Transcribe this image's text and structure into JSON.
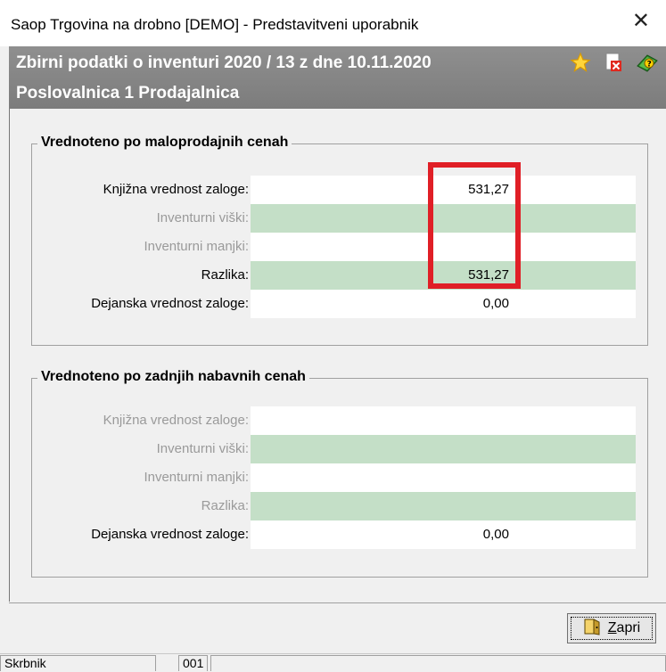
{
  "window": {
    "title": "Saop Trgovina na drobno [DEMO] - Predstavitveni uporabnik",
    "close_glyph": "✕"
  },
  "header": {
    "line1": "Zbirni podatki o inventuri 2020 / 13 z dne 10.11.2020",
    "line2": "Poslovalnica 1 Prodajalnica",
    "icons": [
      "star-icon",
      "pdf-delete-icon",
      "book-help-icon"
    ]
  },
  "group_retail": {
    "legend": "Vrednoteno po maloprodajnih cenah",
    "rows": [
      {
        "label": "Knjižna vrednost zaloge:",
        "value": "531,27"
      },
      {
        "label": "Inventurni viški:",
        "value": ""
      },
      {
        "label": "Inventurni manjki:",
        "value": ""
      },
      {
        "label": "Razlika:",
        "value": "531,27"
      },
      {
        "label": "Dejanska vrednost zaloge:",
        "value": "0,00"
      }
    ]
  },
  "group_purchase": {
    "legend": "Vrednoteno po zadnjih nabavnih cenah",
    "rows": [
      {
        "label": "Knjižna vrednost zaloge:",
        "value": ""
      },
      {
        "label": "Inventurni viški:",
        "value": ""
      },
      {
        "label": "Inventurni manjki:",
        "value": ""
      },
      {
        "label": "Razlika:",
        "value": ""
      },
      {
        "label": "Dejanska vrednost zaloge:",
        "value": "0,00"
      }
    ]
  },
  "buttons": {
    "close_label_underlined": "Z",
    "close_label_rest": "apri"
  },
  "statusbar": {
    "cell1": "Skrbnik",
    "cell2": "001",
    "cell3": ""
  },
  "colors": {
    "row_green": "#c4dfc7",
    "header_gray": "#828282",
    "highlight_red": "#e01f26"
  }
}
